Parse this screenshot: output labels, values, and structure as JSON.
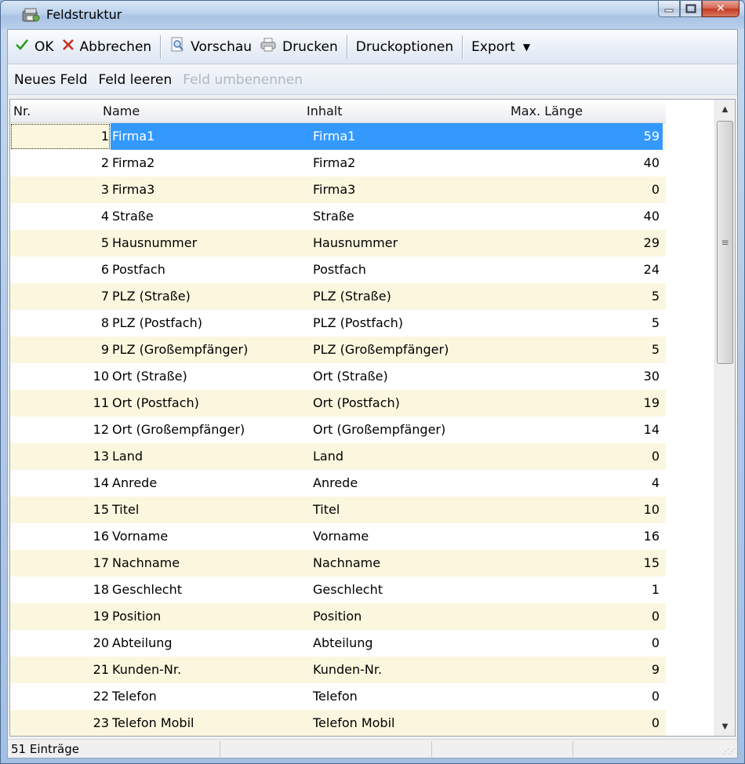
{
  "window": {
    "title": "Feldstruktur"
  },
  "toolbar": {
    "ok": "OK",
    "cancel": "Abbrechen",
    "preview": "Vorschau",
    "print": "Drucken",
    "print_options": "Druckoptionen",
    "export": "Export",
    "ok_color": "#2a9a1c",
    "cancel_color": "#cc2b1f"
  },
  "subbar": {
    "new_field": "Neues Feld",
    "clear_field": "Feld leeren",
    "rename_field": "Feld umbenennen"
  },
  "grid": {
    "columns": [
      "Nr.",
      "Name",
      "Inhalt",
      "Max. Länge"
    ],
    "rows": [
      {
        "nr": "1",
        "name": "Firma1",
        "inhalt": "Firma1",
        "len": "59"
      },
      {
        "nr": "2",
        "name": "Firma2",
        "inhalt": "Firma2",
        "len": "40"
      },
      {
        "nr": "3",
        "name": "Firma3",
        "inhalt": "Firma3",
        "len": "0"
      },
      {
        "nr": "4",
        "name": "Straße",
        "inhalt": "Straße",
        "len": "40"
      },
      {
        "nr": "5",
        "name": "Hausnummer",
        "inhalt": "Hausnummer",
        "len": "29"
      },
      {
        "nr": "6",
        "name": "Postfach",
        "inhalt": "Postfach",
        "len": "24"
      },
      {
        "nr": "7",
        "name": "PLZ (Straße)",
        "inhalt": "PLZ (Straße)",
        "len": "5"
      },
      {
        "nr": "8",
        "name": "PLZ (Postfach)",
        "inhalt": "PLZ (Postfach)",
        "len": "5"
      },
      {
        "nr": "9",
        "name": "PLZ (Großempfänger)",
        "inhalt": "PLZ (Großempfänger)",
        "len": "5"
      },
      {
        "nr": "10",
        "name": "Ort (Straße)",
        "inhalt": "Ort (Straße)",
        "len": "30"
      },
      {
        "nr": "11",
        "name": "Ort (Postfach)",
        "inhalt": "Ort (Postfach)",
        "len": "19"
      },
      {
        "nr": "12",
        "name": "Ort (Großempfänger)",
        "inhalt": "Ort (Großempfänger)",
        "len": "14"
      },
      {
        "nr": "13",
        "name": "Land",
        "inhalt": "Land",
        "len": "0"
      },
      {
        "nr": "14",
        "name": "Anrede",
        "inhalt": "Anrede",
        "len": "4"
      },
      {
        "nr": "15",
        "name": "Titel",
        "inhalt": "Titel",
        "len": "10"
      },
      {
        "nr": "16",
        "name": "Vorname",
        "inhalt": "Vorname",
        "len": "16"
      },
      {
        "nr": "17",
        "name": "Nachname",
        "inhalt": "Nachname",
        "len": "15"
      },
      {
        "nr": "18",
        "name": "Geschlecht",
        "inhalt": "Geschlecht",
        "len": "1"
      },
      {
        "nr": "19",
        "name": "Position",
        "inhalt": "Position",
        "len": "0"
      },
      {
        "nr": "20",
        "name": "Abteilung",
        "inhalt": "Abteilung",
        "len": "0"
      },
      {
        "nr": "21",
        "name": "Kunden-Nr.",
        "inhalt": "Kunden-Nr.",
        "len": "9"
      },
      {
        "nr": "22",
        "name": "Telefon",
        "inhalt": "Telefon",
        "len": "0"
      },
      {
        "nr": "23",
        "name": "Telefon Mobil",
        "inhalt": "Telefon Mobil",
        "len": "0"
      }
    ],
    "selected_row": 0,
    "selection_color": "#3399ff",
    "alt_row_color": "#fbf7de"
  },
  "statusbar": {
    "count": "51 Einträge"
  }
}
